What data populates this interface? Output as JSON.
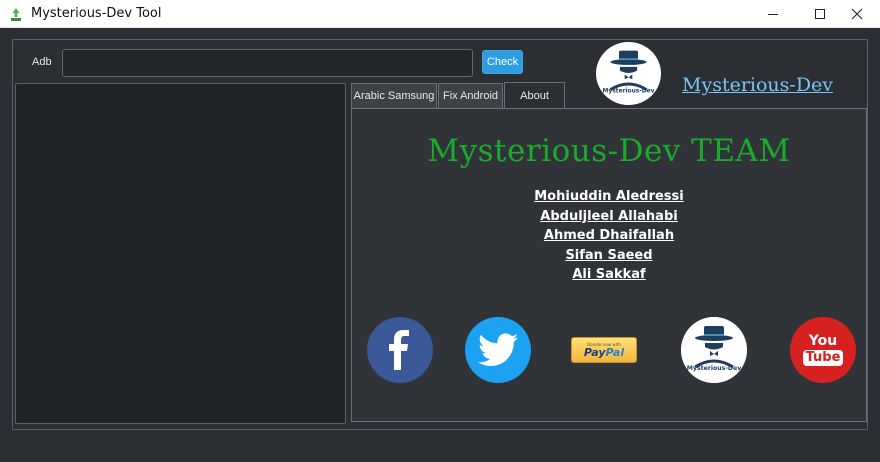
{
  "window": {
    "title": "Mysterious-Dev Tool",
    "controls": [
      "minimize-icon",
      "maximize-icon",
      "close-icon"
    ]
  },
  "toolbar": {
    "adb_label": "Adb",
    "adb_value": "",
    "check_label": "Check",
    "brand_link": "Mysterious-Dev",
    "logo_caption": "Mysterious-Dev"
  },
  "tabs": [
    {
      "label": "Arabic Samsung",
      "selected": false
    },
    {
      "label": "Fix Android",
      "selected": false
    },
    {
      "label": "About",
      "selected": true
    }
  ],
  "about": {
    "title": "Mysterious-Dev TEAM",
    "members": [
      "Mohiuddin Aledressi",
      "Abduljleel Allahabi",
      "Ahmed Dhaifallah",
      "Sifan Saeed",
      "Ali Sakkaf"
    ],
    "social": {
      "paypal_small": "Donate now with",
      "paypal_pay": "Pay",
      "paypal_pal": "Pal",
      "youtube_you": "You",
      "youtube_tube": "Tube",
      "logo_caption": "Mysterious-Dev",
      "icons": [
        "facebook-icon",
        "twitter-icon",
        "paypal-icon",
        "mysterious-dev-logo",
        "youtube-icon"
      ]
    }
  },
  "colors": {
    "background": "#2b2f33",
    "accent_button": "#2f9be0",
    "title_green": "#1aab2a",
    "link_blue": "#79c4f2",
    "facebook": "#3b5998",
    "twitter": "#1da1f2",
    "youtube": "#d72020"
  }
}
